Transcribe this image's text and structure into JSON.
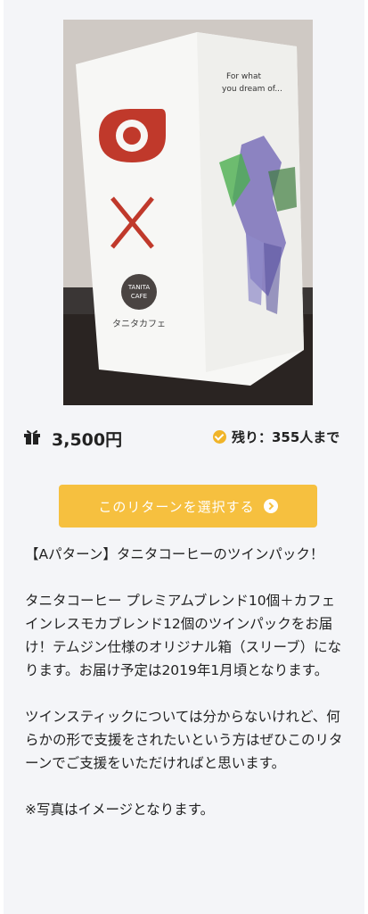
{
  "reward": {
    "price": "3,500円",
    "remaining": "残り：355人まで",
    "icons": {
      "price": "gift-icon",
      "remaining": "check-circle-icon",
      "button": "arrow-circle-icon"
    },
    "select_button": "このリターンを選択する",
    "description": [
      "【Aパターン】タニタコーヒーのツインパック！",
      "タニタコーヒー プレミアムブレンド10個＋カフェインレスモカブレンド12個のツインパックをお届け！テムジン仕様のオリジナル箱（スリーブ）になります。お届け予定は2019年1月頃となります。",
      "ツインスティックについては分からないけれど、何らかの形で支援をされたいという方はぜひこのリターンでご支援をいただければと思います。",
      "※写真はイメージとなります。"
    ]
  },
  "photo": {
    "box_text_en": "For what\nyou dream of...",
    "brand_line1": "TANITA",
    "brand_line2": "CAFE",
    "brand_kana": "タニタカフェ"
  },
  "colors": {
    "accent": "#f6c03f",
    "check": "#f0b429",
    "logo_red": "#c0392b"
  }
}
